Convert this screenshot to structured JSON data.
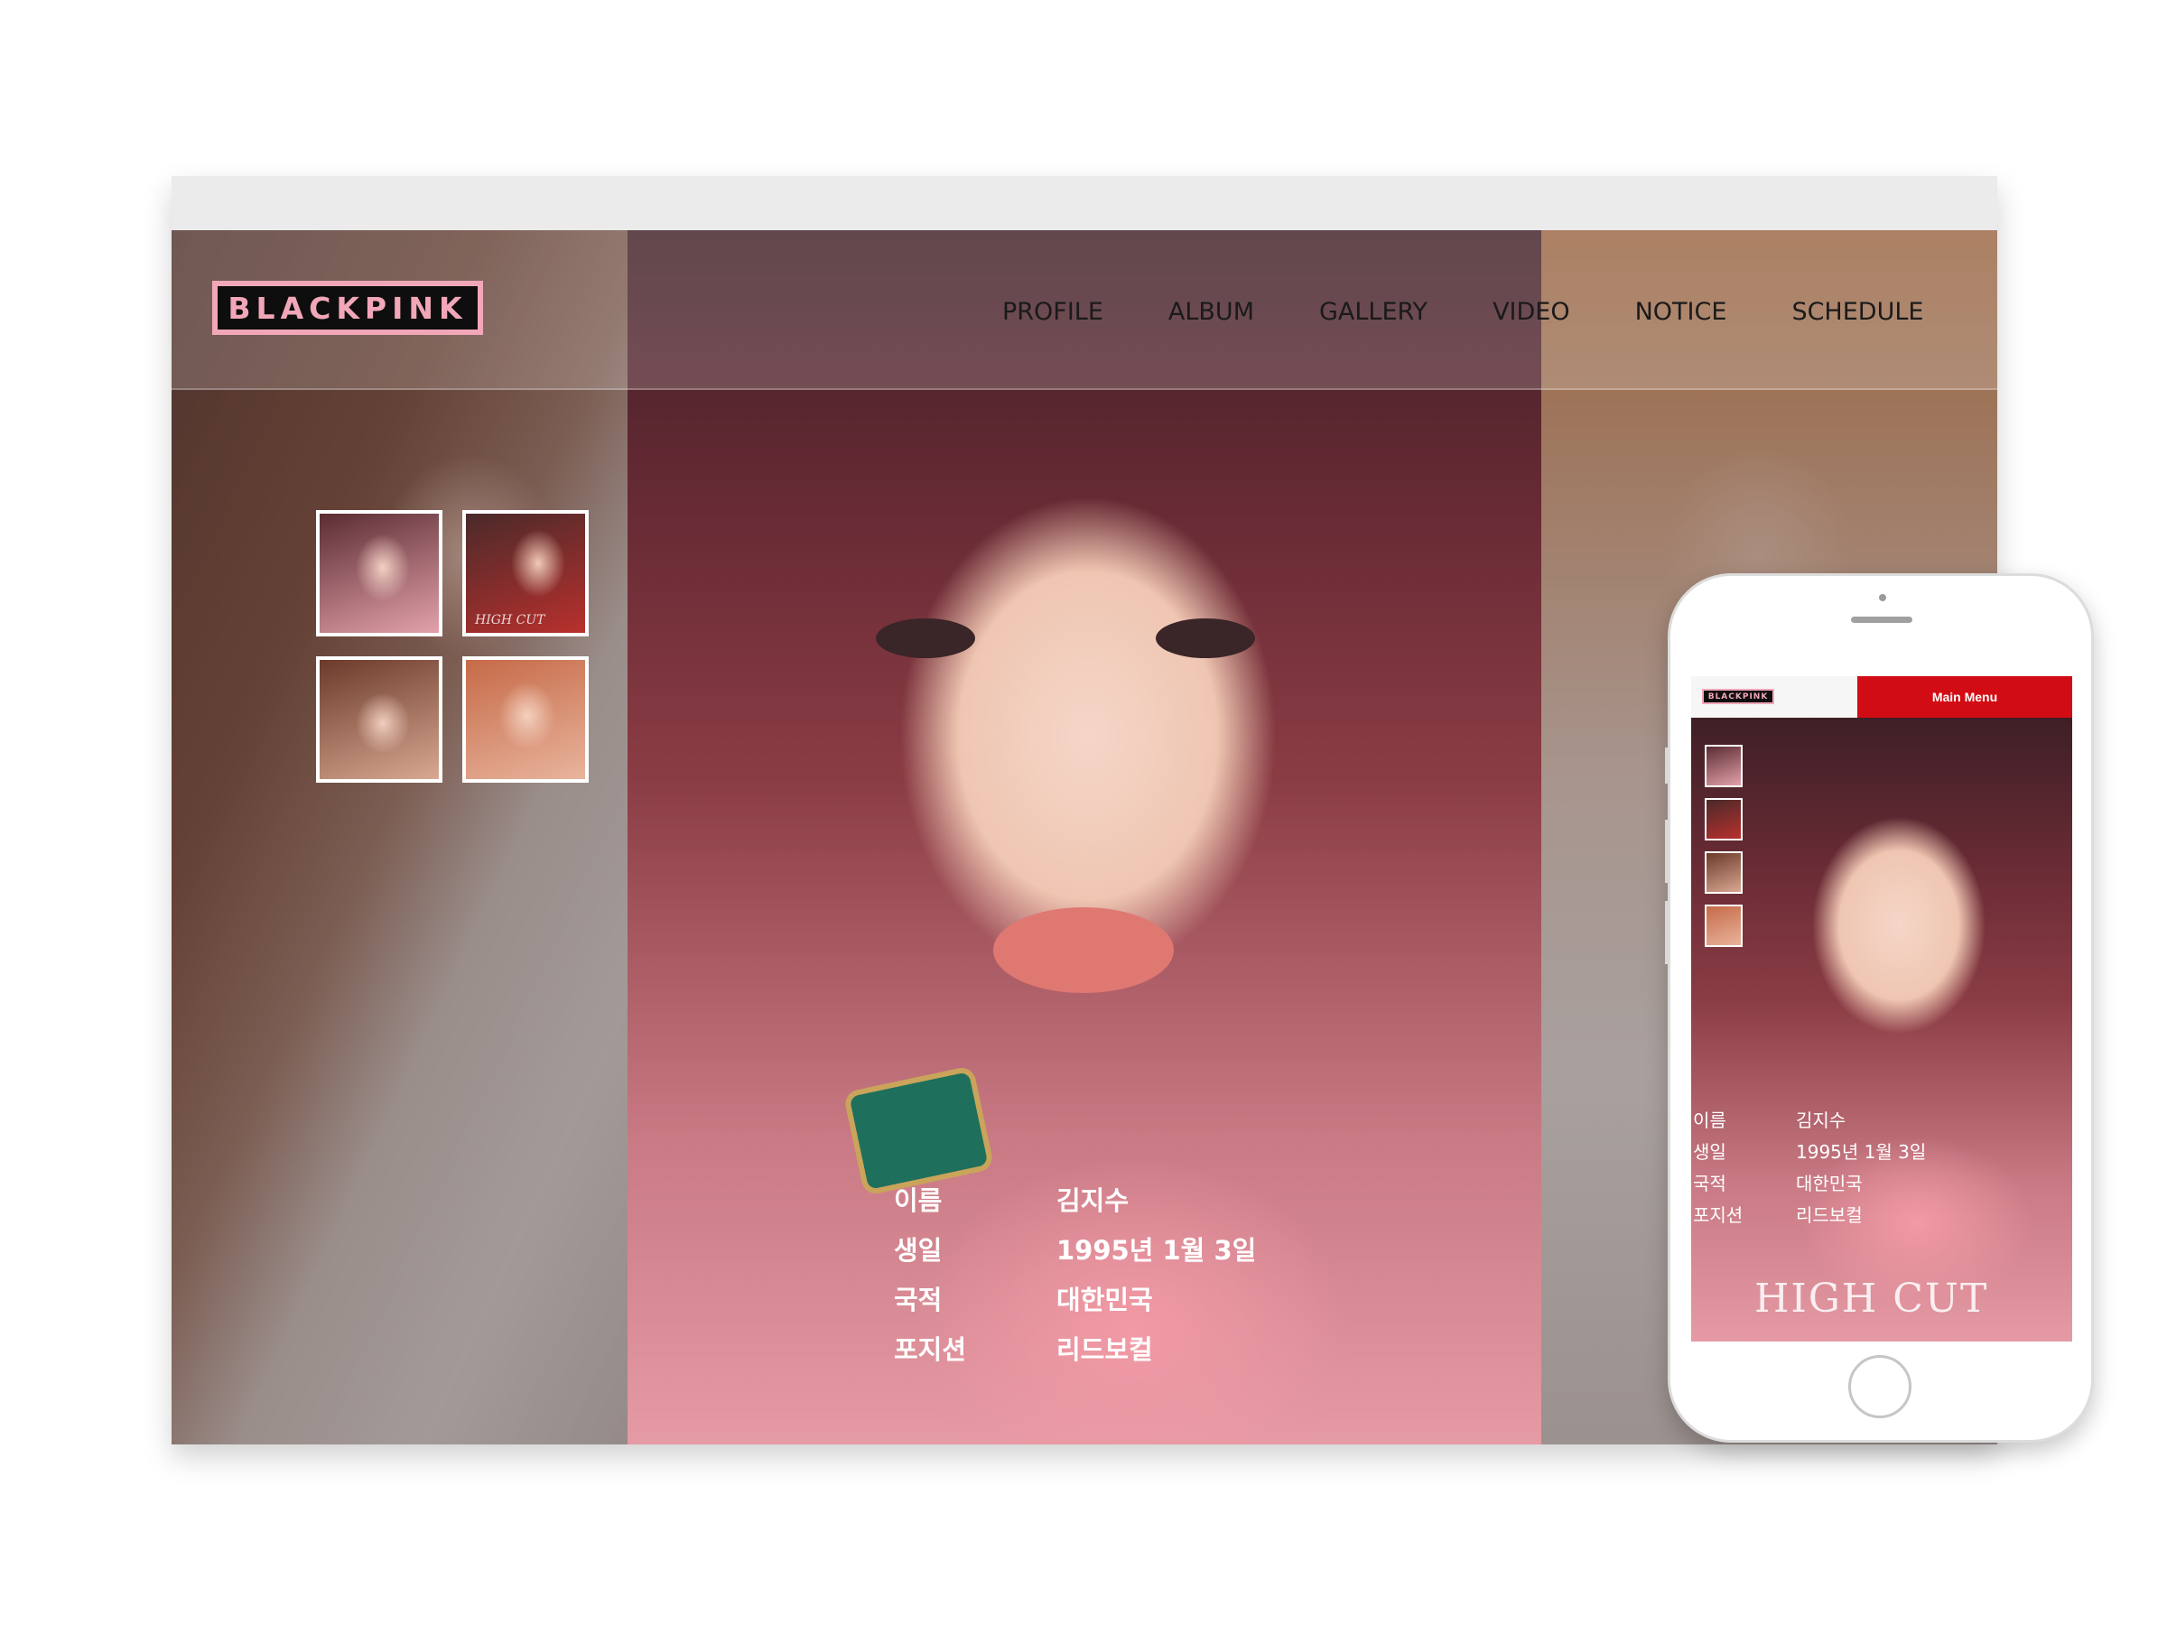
{
  "site": {
    "logo_text": "BLACKPINK"
  },
  "nav": {
    "items": [
      "PROFILE",
      "ALBUM",
      "GALLERY",
      "VIDEO",
      "NOTICE",
      "SCHEDULE"
    ]
  },
  "thumbnails": [
    {
      "caption": ""
    },
    {
      "caption": "HIGH CUT"
    },
    {
      "caption": ""
    },
    {
      "caption": ""
    }
  ],
  "profile": {
    "rows": [
      {
        "label": "이름",
        "value": "김지수"
      },
      {
        "label": "생일",
        "value": "1995년 1월 3일"
      },
      {
        "label": "국적",
        "value": "대한민국"
      },
      {
        "label": "포지션",
        "value": "리드보컬"
      }
    ]
  },
  "mobile": {
    "logo_text": "BLACKPINK",
    "menu_label": "Main Menu",
    "magazine_text": "HIGH CUT"
  },
  "colors": {
    "logo_pink": "#f1a7b8",
    "mobile_menu_red": "#d10c14",
    "info_text": "#ffffff"
  }
}
